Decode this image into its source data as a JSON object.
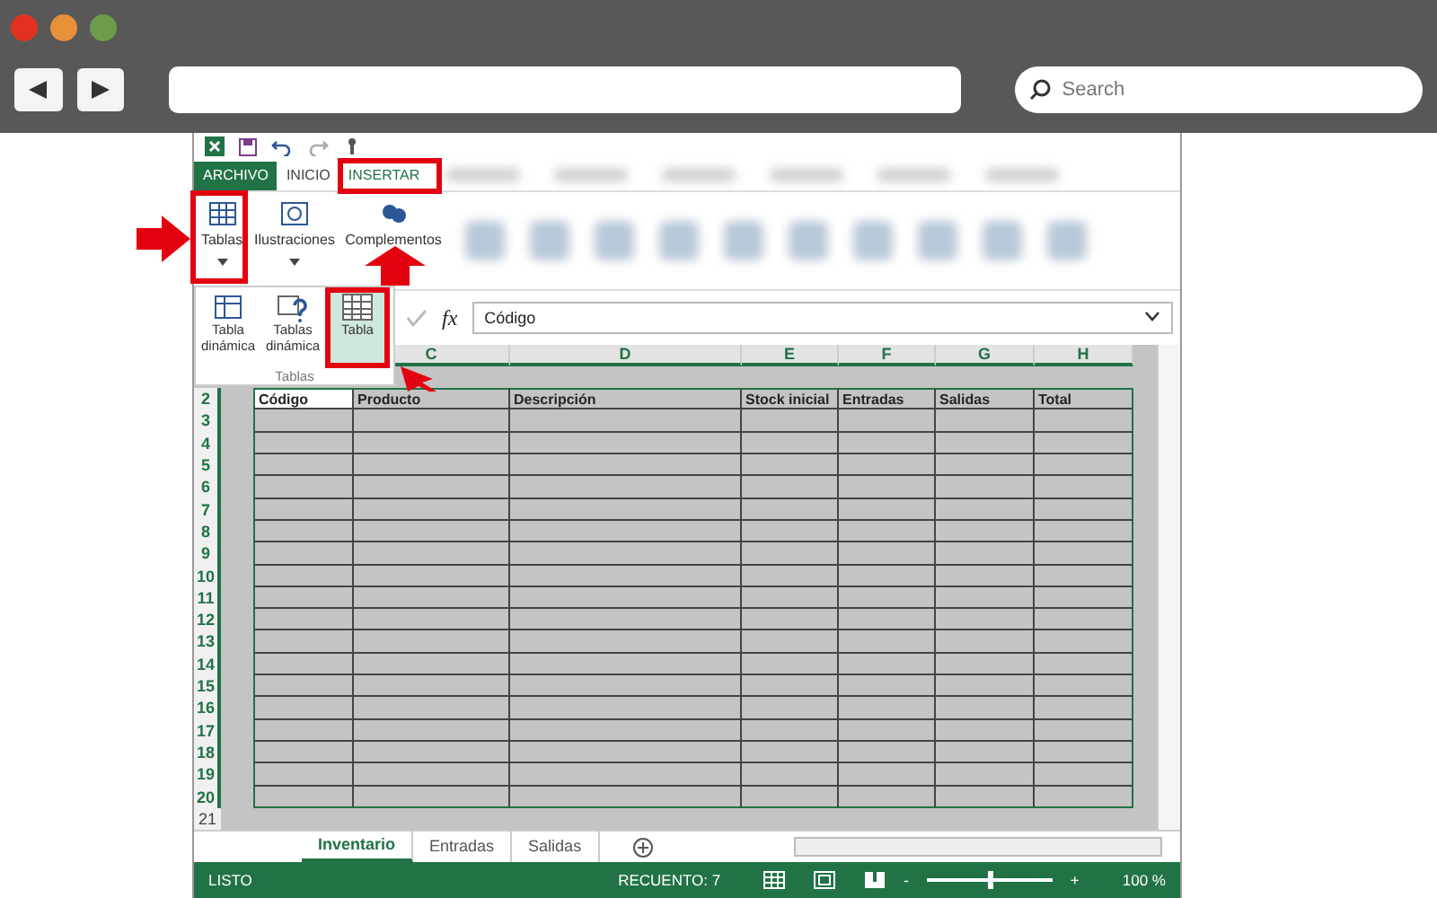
{
  "browser": {
    "search_placeholder": "Search"
  },
  "excel": {
    "tabs": [
      {
        "label": "ARCHIVO",
        "kind": "file",
        "selected": false
      },
      {
        "label": "INICIO",
        "kind": "tab",
        "selected": false
      },
      {
        "label": "INSERTAR",
        "kind": "tab",
        "selected": true
      }
    ],
    "ribbon_groups": [
      {
        "label": "Tablas",
        "kind": "table"
      },
      {
        "label": "Ilustraciones",
        "kind": "shapes"
      },
      {
        "label": "Complementos",
        "kind": "addin"
      }
    ],
    "tables_menu": {
      "items": [
        {
          "label": "Tabla dinámica",
          "selected": false
        },
        {
          "label": "Tablas dinámica",
          "selected": false
        },
        {
          "label": "Tabla",
          "selected": true
        }
      ],
      "group_label": "Tablas"
    },
    "formula_bar": {
      "fx": "fx",
      "value": "Código"
    },
    "columns": [
      "C",
      "D",
      "E",
      "F",
      "G",
      "H"
    ],
    "row_numbers": [
      "2",
      "3",
      "4",
      "5",
      "6",
      "7",
      "8",
      "9",
      "10",
      "11",
      "12",
      "13",
      "14",
      "15",
      "16",
      "17",
      "18",
      "19",
      "20",
      "21"
    ],
    "header_row": [
      "Código",
      "Producto",
      "Descripción",
      "Stock inicial",
      "Entradas",
      "Salidas",
      "Total"
    ],
    "sheet_tabs": [
      {
        "label": "Inventario",
        "selected": true
      },
      {
        "label": "Entradas",
        "selected": false
      },
      {
        "label": "Salidas",
        "selected": false
      }
    ],
    "status_bar": {
      "mode": "LISTO",
      "count": "RECUENTO: 7",
      "zoom_out": "-",
      "zoom_in": "+",
      "zoom": "100 %",
      "level": 0.5
    }
  }
}
